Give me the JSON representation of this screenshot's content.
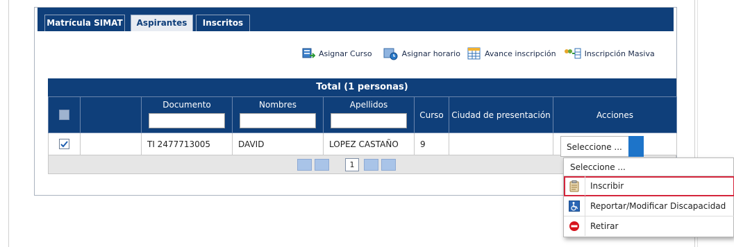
{
  "tabs": [
    {
      "label": "Matrícula SIMAT"
    },
    {
      "label": "Aspirantes"
    },
    {
      "label": "Inscritos"
    }
  ],
  "toolbar": {
    "asignar_curso": "Asignar Curso",
    "asignar_horario": "Asignar horario",
    "avance_inscripcion": "Avance inscripción",
    "inscripcion_masiva": "Inscripción Masiva"
  },
  "grid": {
    "title": "Total (1 personas)",
    "columns": {
      "documento": "Documento",
      "nombres": "Nombres",
      "apellidos": "Apellidos",
      "curso": "Curso",
      "ciudad": "Ciudad de presentación",
      "acciones": "Acciones"
    },
    "rows": [
      {
        "documento": "TI 2477713005",
        "nombres": "DAVID",
        "apellidos": "LOPEZ CASTAÑO",
        "curso": "9",
        "ciudad": ""
      }
    ],
    "page": "1"
  },
  "action_select": {
    "value": "Seleccione ..."
  },
  "dropdown": {
    "header": "Seleccione ...",
    "items": [
      {
        "label": "Inscribir",
        "icon": "clipboard-icon"
      },
      {
        "label": "Reportar/Modificar Discapacidad",
        "icon": "wheelchair-icon"
      },
      {
        "label": "Retirar",
        "icon": "stop-icon"
      }
    ]
  },
  "colors": {
    "header_blue": "#0f3f7a",
    "select_button": "#1d74c9",
    "highlight_border": "#d4253b"
  }
}
